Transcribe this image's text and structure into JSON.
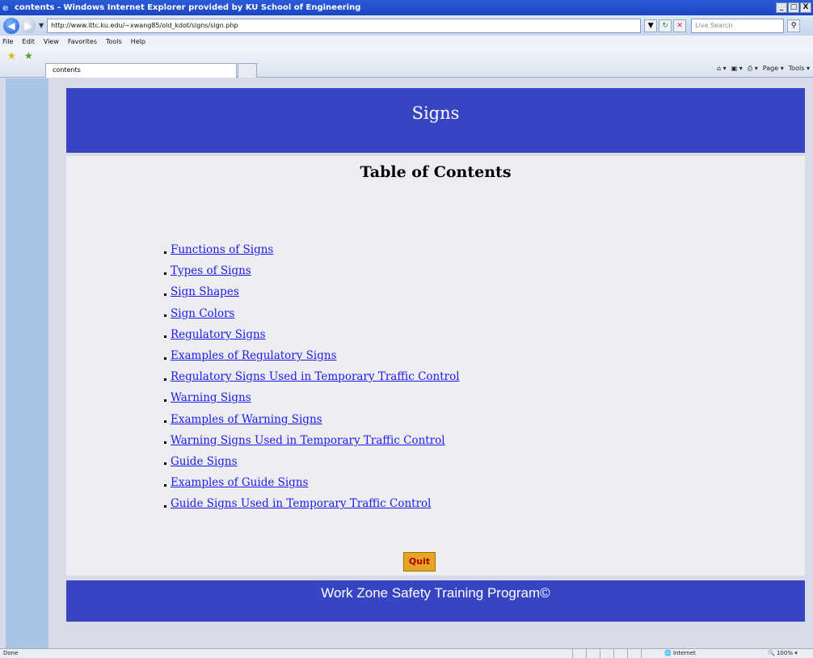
{
  "window": {
    "title": "contents - Windows Internet Explorer provided by KU School of Engineering",
    "minimize": "_",
    "restore": "□",
    "close": "X"
  },
  "addressbar": {
    "url": "http://www.ittc.ku.edu/~xwang85/old_kdot/signs/sign.php",
    "search_placeholder": "Live Search"
  },
  "menu": [
    "File",
    "Edit",
    "View",
    "Favorites",
    "Tools",
    "Help"
  ],
  "tab": {
    "label": "contents"
  },
  "commandbar": {
    "page": "Page",
    "tools": "Tools"
  },
  "page": {
    "banner_title": "Signs",
    "toc_title": "Table of Contents",
    "toc_items": [
      "Functions of Signs",
      "Types of Signs",
      "Sign Shapes",
      "Sign Colors",
      "Regulatory Signs",
      "Examples of Regulatory Signs",
      "Regulatory Signs Used in Temporary Traffic Control",
      "Warning Signs",
      "Examples of Warning Signs",
      "Warning Signs Used in Temporary Traffic Control",
      "Guide Signs",
      "Examples of Guide Signs",
      "Guide Signs Used in Temporary Traffic Control"
    ],
    "quit_label": "Quit",
    "footer": "Work Zone Safety Training Program©"
  },
  "status": {
    "left": "Done",
    "zone": "Internet",
    "zoom": "100%"
  },
  "colors": {
    "banner": "#3845c2",
    "link": "#1a1aee",
    "quit_bg": "#e6a522",
    "quit_text": "#b00000"
  }
}
